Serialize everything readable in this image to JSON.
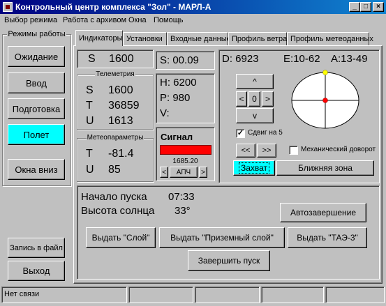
{
  "window": {
    "title": "Контрольный центр комплекса \"Зол\" - МАРЛ-А"
  },
  "menu": [
    "Выбор режима",
    "Работа с архивом",
    "Окна",
    "Помощь"
  ],
  "left_panel": {
    "title": "Режимы работы",
    "buttons": [
      "Ожидание",
      "Ввод",
      "Подготовка",
      "Полет",
      "Окна вниз"
    ],
    "active_button": "Полет",
    "record_button": "Запись в файл",
    "exit_button": "Выход"
  },
  "tabs": [
    "Индикаторы",
    "Установки",
    "Входные данные",
    "Профиль ветра",
    "Профиль метеоданных"
  ],
  "indicators": {
    "s_top": {
      "label": "S",
      "value": "1600"
    },
    "telemetry": {
      "title": "Телеметрия",
      "rows": [
        {
          "label": "S",
          "value": "1600"
        },
        {
          "label": "T",
          "value": "36859"
        },
        {
          "label": "U",
          "value": "1613"
        }
      ]
    },
    "meteo": {
      "title": "Метеопараметры",
      "rows": [
        {
          "label": "T",
          "value": "-81.4"
        },
        {
          "label": "U",
          "value": "85"
        }
      ]
    },
    "s_time": "S: 00.09",
    "hpv": {
      "h": "H: 6200",
      "p": "P: 980",
      "v": "V:"
    },
    "signal": {
      "title": "Сигнал",
      "frequency": "1685.20",
      "apch_label": "АПЧ",
      "bar_color": "#ff0000"
    },
    "right": {
      "d": "D: 6923",
      "e": "E:10-62",
      "a": "A:13-49",
      "center_value": "0",
      "up_arrow": "^",
      "down_arrow": "v",
      "left_arrow": "<",
      "right_arrow": ">",
      "shift_label": "Сдвиг на 5",
      "shift_checked": true,
      "step_back": "<<",
      "step_fwd": ">>",
      "mech_label": "Механический доворот",
      "mech_checked": false,
      "capture_label": "Захват",
      "near_zone_label": "Ближняя зона"
    },
    "launch": {
      "start_label": "Начало пуска",
      "start_value": "07:33",
      "sun_label": "Высота солнца",
      "sun_value": "33°",
      "auto_button": "Автозавершение",
      "btn_layer": "Выдать \"Слой\"",
      "btn_ground": "Выдать \"Приземный слой\"",
      "btn_tae": "Выдать \"ТАЭ-3\"",
      "btn_finish": "Завершить пуск"
    }
  },
  "status": {
    "text": "Нет связи"
  },
  "colors": {
    "title_start": "#000080",
    "title_end": "#1084d0",
    "active_mode": "#00ffff",
    "signal": "#ff0000",
    "scope_center": "#ff0000",
    "scope_top": "#ffff00"
  }
}
